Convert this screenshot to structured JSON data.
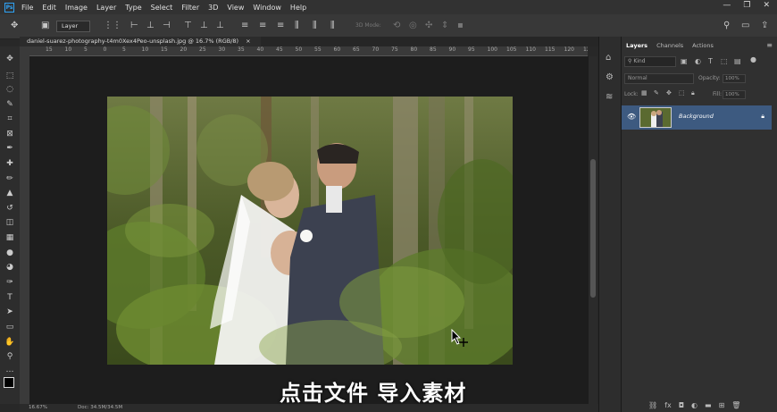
{
  "app": {
    "logo": "Ps"
  },
  "menu": [
    "File",
    "Edit",
    "Image",
    "Layer",
    "Type",
    "Select",
    "Filter",
    "3D",
    "View",
    "Window",
    "Help"
  ],
  "window_controls": [
    "—",
    "❐",
    "✕"
  ],
  "options_bar": {
    "layer_select": "Layer",
    "mode_3d": "3D Mode:"
  },
  "document": {
    "tab_title": "daniel-suarez-photography-t4m0Xex4Peo-unsplash.jpg @ 16.7% (RGB/8)",
    "close": "×"
  },
  "ruler_ticks": [
    "15",
    "10",
    "5",
    "0",
    "5",
    "10",
    "15",
    "20",
    "25",
    "30",
    "35",
    "40",
    "45",
    "50",
    "55",
    "60",
    "65",
    "70",
    "75",
    "80",
    "85",
    "90",
    "95",
    "100",
    "105",
    "110",
    "115",
    "120",
    "125"
  ],
  "panels": {
    "tabs": [
      "Layers",
      "Channels",
      "Actions"
    ],
    "kind_label": "Kind",
    "blend_mode": "Normal",
    "opacity_label": "Opacity:",
    "opacity_value": "100%",
    "lock_label": "Lock:",
    "fill_label": "Fill:",
    "fill_value": "100%",
    "layer": {
      "name": "Background"
    }
  },
  "status": {
    "zoom": "16.67%",
    "doc": "Doc: 34.5M/34.5M"
  },
  "subtitle": "点击文件 导入素材",
  "colors": {
    "accent": "#2fa3f7",
    "layer_selected": "#3d5a80",
    "panel_bg": "#303030"
  }
}
